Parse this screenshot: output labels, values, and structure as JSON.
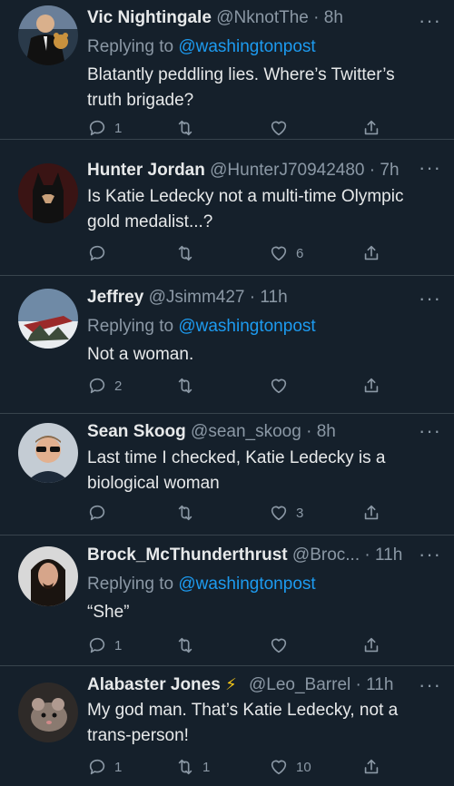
{
  "tweets": [
    {
      "name": "Vic Nightingale",
      "handle": "@NknotThe",
      "time": "8h",
      "replying_prefix": "Replying to ",
      "replying_to": "@washingtonpost",
      "text": "Blatantly peddling lies. Where’s Twitter’s truth brigade?",
      "replies": "1",
      "retweets": "",
      "likes": "",
      "avatar": "avatar-man-with-teddy-bear"
    },
    {
      "name": "Hunter Jordan",
      "handle": "@HunterJ70942480",
      "time": "7h",
      "replying_prefix": "",
      "replying_to": "",
      "text": "Is Katie Ledecky not a multi-time Olympic gold medalist...?",
      "replies": "",
      "retweets": "",
      "likes": "6",
      "avatar": "avatar-batman"
    },
    {
      "name": "Jeffrey",
      "handle": "@Jsimm427",
      "time": "11h",
      "replying_prefix": "Replying to ",
      "replying_to": "@washingtonpost",
      "text": "Not a woman.",
      "replies": "2",
      "retweets": "",
      "likes": "",
      "avatar": "avatar-snowy-boat"
    },
    {
      "name": "Sean Skoog",
      "handle": "@sean_skoog",
      "time": "8h",
      "replying_prefix": "",
      "replying_to": "",
      "text": "Last time I checked, Katie Ledecky is a biological woman",
      "replies": "",
      "retweets": "",
      "likes": "3",
      "avatar": "avatar-man-sunglasses"
    },
    {
      "name": "Brock_McThunderthrust",
      "handle": "@Broc...",
      "time": "11h",
      "replying_prefix": "Replying to ",
      "replying_to": "@washingtonpost",
      "text": "“She”",
      "replies": "1",
      "retweets": "",
      "likes": "",
      "avatar": "avatar-long-hair-man"
    },
    {
      "name": "Alabaster Jones",
      "name_emoji": "⚡",
      "handle": "@Leo_Barrel",
      "time": "11h",
      "replying_prefix": "",
      "replying_to": "",
      "text": "My god man. That’s Katie Ledecky, not a trans-person!",
      "replies": "1",
      "retweets": "1",
      "likes": "10",
      "avatar": "avatar-rat"
    }
  ],
  "ui": {
    "dot": "·",
    "more": "···"
  },
  "colors": {
    "background": "#15202b",
    "mention": "#1d9bf0",
    "muted": "#8b98a5",
    "divider": "#38444d"
  }
}
